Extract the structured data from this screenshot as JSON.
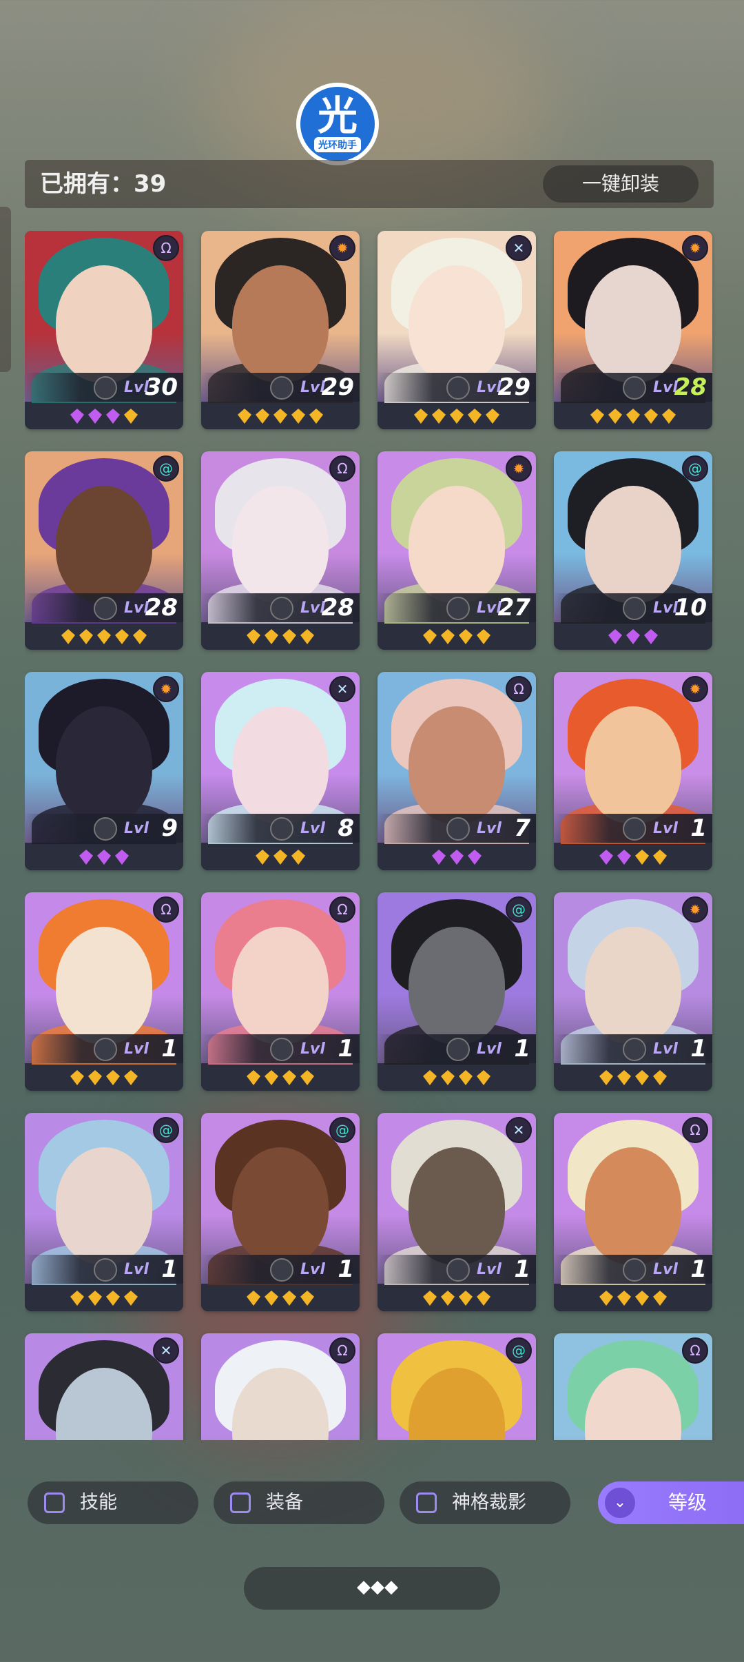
{
  "header": {
    "owned_label": "已拥有：39",
    "unequip_button": "一键卸装"
  },
  "logo": {
    "glyph": "光",
    "caption": "光环助手"
  },
  "heroes": [
    {
      "level": "30",
      "stars": [
        "purple",
        "purple",
        "purple",
        "gold"
      ],
      "faction": "omega-icon",
      "palette": [
        "#b7323b",
        "#2a7f7a",
        "#f0d2c0"
      ]
    },
    {
      "level": "29",
      "stars": [
        "gold",
        "gold",
        "gold",
        "gold",
        "gold"
      ],
      "faction": "sun-icon",
      "palette": [
        "#e9b58a",
        "#2b2624",
        "#b77a58"
      ]
    },
    {
      "level": "29",
      "stars": [
        "gold",
        "gold",
        "gold",
        "gold",
        "gold"
      ],
      "faction": "cross-icon",
      "palette": [
        "#f1d9c3",
        "#f2efe3",
        "#f7e2d3"
      ]
    },
    {
      "level": "28",
      "stars": [
        "gold",
        "gold",
        "gold",
        "gold",
        "gold"
      ],
      "faction": "sun-icon",
      "palette": [
        "#f0a36e",
        "#1d1b1f",
        "#e7d6cf"
      ]
    },
    {
      "level": "28",
      "stars": [
        "gold",
        "gold",
        "gold",
        "gold",
        "gold"
      ],
      "faction": "spiral-icon",
      "palette": [
        "#e7a57a",
        "#6a3b9a",
        "#6b4532"
      ]
    },
    {
      "level": "28",
      "stars": [
        "gold",
        "gold",
        "gold",
        "gold"
      ],
      "faction": "omega-icon",
      "palette": [
        "#c889e0",
        "#e8e4ec",
        "#f2e6ea"
      ]
    },
    {
      "level": "27",
      "stars": [
        "gold",
        "gold",
        "gold",
        "gold"
      ],
      "faction": "sun-icon",
      "palette": [
        "#c88be8",
        "#c9d49a",
        "#f6dac9"
      ]
    },
    {
      "level": "10",
      "stars": [
        "purple",
        "purple",
        "purple"
      ],
      "faction": "spiral-icon",
      "palette": [
        "#7ab9e0",
        "#1e1f24",
        "#e9d2c7"
      ]
    },
    {
      "level": "9",
      "stars": [
        "purple",
        "purple",
        "purple"
      ],
      "faction": "sun-icon",
      "palette": [
        "#7ab3d9",
        "#1d1a2a",
        "#2a2838"
      ]
    },
    {
      "level": "8",
      "stars": [
        "gold",
        "gold",
        "gold"
      ],
      "faction": "cross-icon",
      "palette": [
        "#c78bec",
        "#cfeef3",
        "#f3dbe2"
      ]
    },
    {
      "level": "7",
      "stars": [
        "purple",
        "purple",
        "purple"
      ],
      "faction": "omega-icon",
      "palette": [
        "#7db5de",
        "#ecc7be",
        "#c78c72"
      ]
    },
    {
      "level": "1",
      "stars": [
        "purple",
        "purple",
        "gold",
        "gold"
      ],
      "faction": "sun-icon",
      "palette": [
        "#c98ee7",
        "#e85b2c",
        "#f2c49b"
      ]
    },
    {
      "level": "1",
      "stars": [
        "gold",
        "gold",
        "gold",
        "gold"
      ],
      "faction": "omega-icon",
      "palette": [
        "#c58ae9",
        "#f07c31",
        "#f3e2d0"
      ]
    },
    {
      "level": "1",
      "stars": [
        "gold",
        "gold",
        "gold",
        "gold"
      ],
      "faction": "omega-icon",
      "palette": [
        "#c68ae6",
        "#ea7e8f",
        "#f3d3c8"
      ]
    },
    {
      "level": "1",
      "stars": [
        "gold",
        "gold",
        "gold",
        "gold"
      ],
      "faction": "spiral-icon",
      "palette": [
        "#9d7ae0",
        "#1e1d22",
        "#6b6b72"
      ]
    },
    {
      "level": "1",
      "stars": [
        "gold",
        "gold",
        "gold",
        "gold"
      ],
      "faction": "sun-icon",
      "palette": [
        "#b78be2",
        "#c4d4e6",
        "#e9d6c8"
      ]
    },
    {
      "level": "1",
      "stars": [
        "gold",
        "gold",
        "gold",
        "gold"
      ],
      "faction": "spiral-icon",
      "palette": [
        "#b98ae6",
        "#a3c9e4",
        "#e7d5ce"
      ]
    },
    {
      "level": "1",
      "stars": [
        "gold",
        "gold",
        "gold",
        "gold"
      ],
      "faction": "spiral-icon",
      "palette": [
        "#c58ae6",
        "#5a3322",
        "#7a4a35"
      ]
    },
    {
      "level": "1",
      "stars": [
        "gold",
        "gold",
        "gold",
        "gold"
      ],
      "faction": "cross-icon",
      "palette": [
        "#c48ae7",
        "#e2ddd3",
        "#6b5b4e"
      ]
    },
    {
      "level": "1",
      "stars": [
        "gold",
        "gold",
        "gold",
        "gold"
      ],
      "faction": "omega-icon",
      "palette": [
        "#c68ae8",
        "#f1e6c6",
        "#d48a5a"
      ]
    },
    {
      "level": "",
      "stars": [],
      "faction": "cross-icon",
      "palette": [
        "#b98ae5",
        "#2b2c33",
        "#b8c7d3"
      ]
    },
    {
      "level": "",
      "stars": [],
      "faction": "omega-icon",
      "palette": [
        "#b98ae5",
        "#eef2f6",
        "#e9dad0"
      ]
    },
    {
      "level": "",
      "stars": [],
      "faction": "spiral-icon",
      "palette": [
        "#c48ae7",
        "#f0c040",
        "#e0a030"
      ]
    },
    {
      "level": "",
      "stars": [],
      "faction": "omega-icon",
      "palette": [
        "#8ec2e0",
        "#7cd0a8",
        "#f0d8cc"
      ]
    }
  ],
  "level_label": "Lvl",
  "filters": {
    "skill": "技能",
    "equipment": "装备",
    "divine": "神格裁影",
    "sort": "等级"
  },
  "colors": {
    "accent": "#9a7cff",
    "gold_gem": "#f4b526",
    "purple_gem": "#c05df0"
  }
}
